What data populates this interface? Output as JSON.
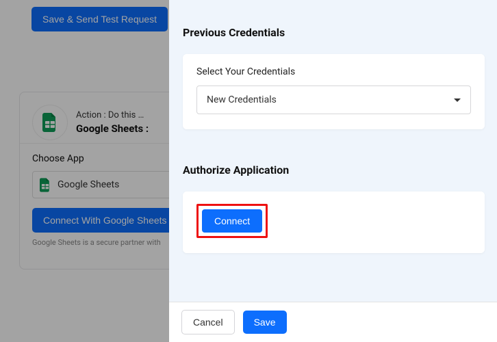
{
  "background": {
    "save_test_request": "Save & Send Test Request",
    "action_line1": "Action : Do this …",
    "action_line2": "Google Sheets : ",
    "choose_app_label": "Choose App",
    "app_selected": "Google Sheets",
    "connect_with": "Connect With Google Sheets",
    "secure_note": "Google Sheets is a secure partner with"
  },
  "modal": {
    "panel1": {
      "title": "Previous Credentials",
      "field_label": "Select Your Credentials",
      "selected": "New Credentials"
    },
    "panel2": {
      "title": "Authorize Application",
      "connect": "Connect"
    },
    "footer": {
      "cancel": "Cancel",
      "save": "Save"
    }
  }
}
